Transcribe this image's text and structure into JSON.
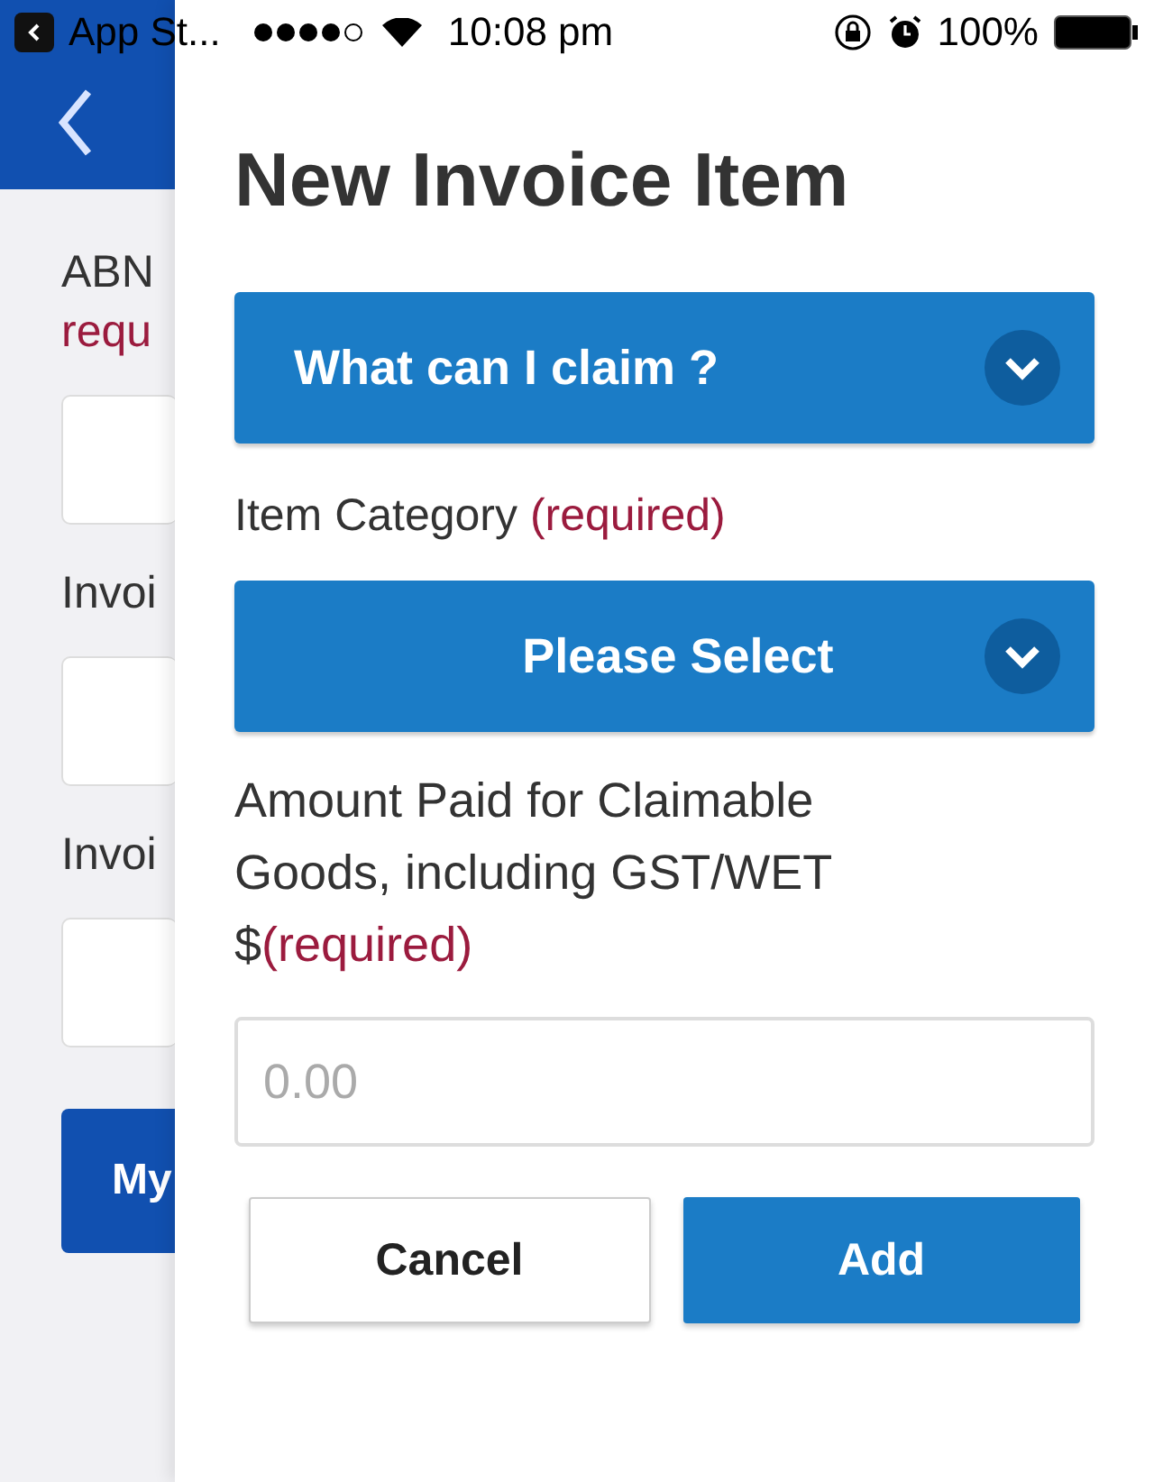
{
  "status_bar": {
    "back_app": "App St...",
    "time": "10:08 pm",
    "battery": "100%"
  },
  "background_page": {
    "fields": [
      {
        "label": "ABN",
        "required": "requ"
      },
      {
        "label": "Invoi"
      },
      {
        "label": "Invoi"
      }
    ],
    "button": "My"
  },
  "dialog": {
    "title": "New Invoice Item",
    "accordion": {
      "label": "What can I claim ?",
      "expanded": false
    },
    "category": {
      "label": "Item Category",
      "required": "(required)",
      "select": "Please Select"
    },
    "amount": {
      "label_lines": [
        "Amount Paid for Claimable",
        "Goods, including GST/WET",
        "$"
      ],
      "required": "(required)",
      "placeholder": "0.00"
    },
    "buttons": [
      {
        "label": "Cancel",
        "kind": "secondary"
      },
      {
        "label": "Add",
        "kind": "primary"
      }
    ]
  }
}
